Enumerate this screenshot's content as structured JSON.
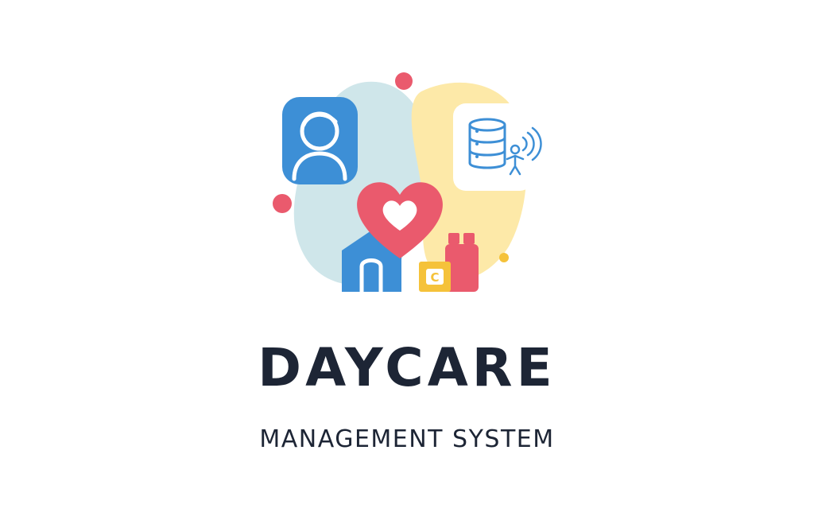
{
  "brand": {
    "title": "DAYCARE",
    "subtitle": "MANAGEMENT SYSTEM",
    "colors": {
      "text": "#1d2535",
      "blob_blue": "#cfe6ea",
      "blob_yellow": "#fde9a8",
      "primary_blue": "#3d8fd6",
      "heart_red": "#ea5a6d",
      "accent_yellow": "#f5c23a"
    }
  },
  "logo": {
    "icons": [
      "child-avatar-icon",
      "database-server-icon",
      "wireless-signal-icon",
      "heart-icon",
      "house-icon",
      "gift-blocks-icon"
    ],
    "block_letter": "C"
  }
}
